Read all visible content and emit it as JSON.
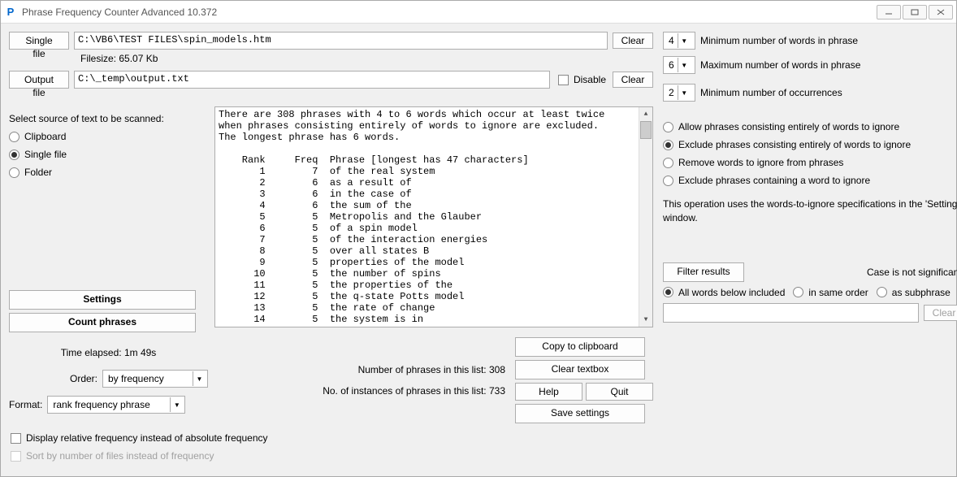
{
  "titlebar": {
    "icon_letter": "P",
    "title": "Phrase Frequency Counter Advanced 10.372"
  },
  "top": {
    "single_file_btn": "Single file",
    "single_file_path": "C:\\VB6\\TEST FILES\\spin_models.htm",
    "filesize": "Filesize: 65.07 Kb",
    "output_file_btn": "Output file",
    "output_file_path": "C:\\_temp\\output.txt",
    "disable": "Disable",
    "clear": "Clear"
  },
  "source": {
    "label": "Select source of text to be scanned:",
    "clipboard": "Clipboard",
    "single_file": "Single file",
    "folder": "Folder"
  },
  "left_buttons": {
    "settings": "Settings",
    "count": "Count phrases"
  },
  "stats": {
    "time_elapsed": "Time elapsed: 1m 49s",
    "order_label": "Order:",
    "order_value": "by frequency",
    "format_label": "Format:",
    "format_value": "rank frequency phrase",
    "num_phrases": "Number of phrases in this list: 308",
    "num_instances": "No. of instances of phrases in this list: 733"
  },
  "center_buttons": {
    "copy": "Copy to clipboard",
    "clear_tb": "Clear textbox",
    "help": "Help",
    "quit": "Quit",
    "save": "Save settings"
  },
  "bottom_checks": {
    "relative": "Display relative frequency instead of absolute frequency",
    "sortfiles": "Sort by number of files instead of frequency"
  },
  "results_text": "There are 308 phrases with 4 to 6 words which occur at least twice\nwhen phrases consisting entirely of words to ignore are excluded.\nThe longest phrase has 6 words.\n\n    Rank     Freq  Phrase [longest has 47 characters]\n       1        7  of the real system\n       2        6  as a result of\n       3        6  in the case of\n       4        6  the sum of the\n       5        5  Metropolis and the Glauber\n       6        5  of a spin model\n       7        5  of the interaction energies\n       8        5  over all states B\n       9        5  properties of the model\n      10        5  the number of spins\n      11        5  the properties of the\n      12        5  the q-state Potts model\n      13        5  the rate of change\n      14        5  the system is in",
  "right": {
    "min_words_val": "4",
    "min_words_lbl": "Minimum number of words in phrase",
    "max_words_val": "6",
    "max_words_lbl": "Maximum number of words in phrase",
    "min_occ_val": "2",
    "min_occ_lbl": "Minimum number of occurrences",
    "opt_allow": "Allow phrases consisting entirely of words to ignore",
    "opt_exclude_all": "Exclude phrases consisting entirely of words to ignore",
    "opt_remove": "Remove words to ignore from phrases",
    "opt_exclude_any": "Exclude phrases containing a word to ignore",
    "note": "This operation uses the words-to-ignore specifications in the 'Settings' window.",
    "filter_btn": "Filter results",
    "case_note": "Case is not significant.",
    "f_all": "All words below included",
    "f_order": "in same order",
    "f_sub": "as subphrase",
    "clear": "Clear"
  }
}
